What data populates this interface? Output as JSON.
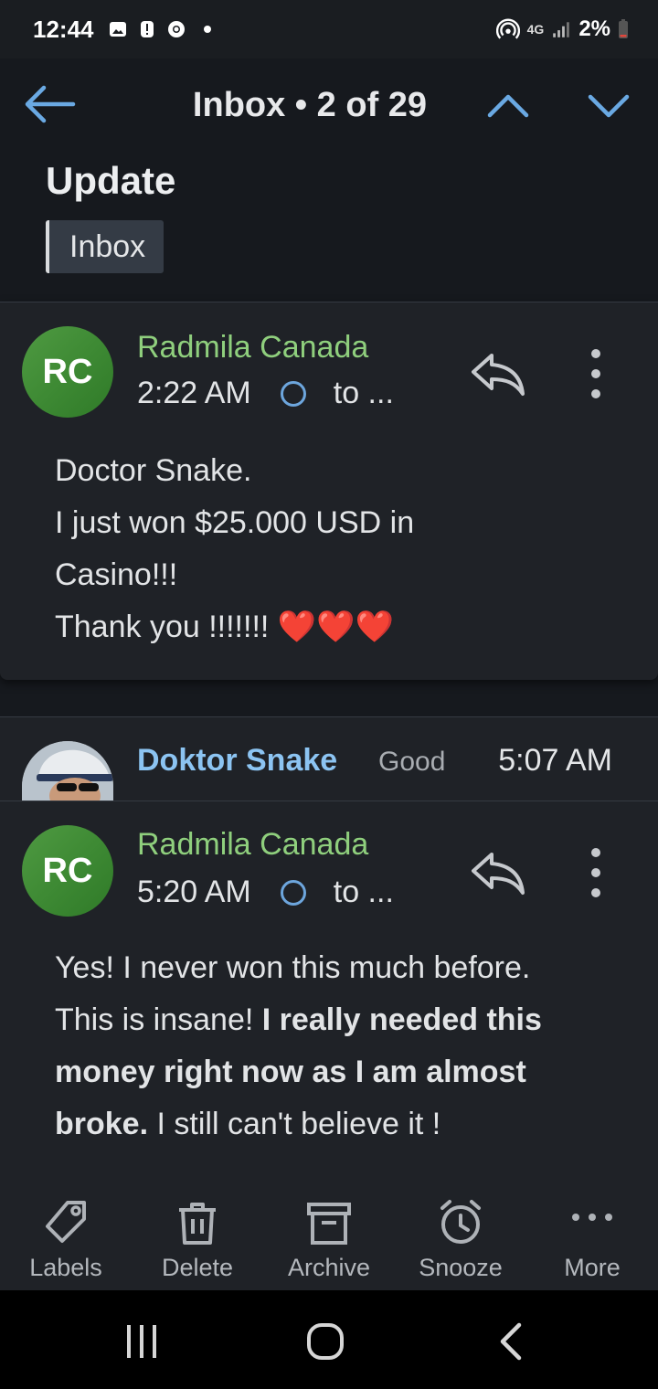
{
  "status_bar": {
    "time": "12:44",
    "network": "4G",
    "battery": "2%",
    "icons": [
      "gallery-icon",
      "alert-icon",
      "chrome-icon",
      "dot-icon",
      "hotspot-icon",
      "signal-icon",
      "battery-icon"
    ]
  },
  "header": {
    "title": "Inbox • 2 of 29",
    "subject": "Update",
    "label": "Inbox"
  },
  "messages": [
    {
      "avatar_initials": "RC",
      "sender": "Radmila Canada",
      "time": "2:22 AM",
      "recipient": "to ...",
      "body": [
        "Doctor Snake.",
        "I just won $25.000 USD in",
        "Casino!!!",
        "Thank you !!!!!!! ❤️❤️❤️"
      ]
    },
    {
      "sender": "Doktor Snake",
      "snippet": "Good",
      "time": "5:07 AM"
    },
    {
      "avatar_initials": "RC",
      "sender": "Radmila Canada",
      "time": "5:20 AM",
      "recipient": "to ...",
      "body_plain_1": "Yes! I never won this much before.",
      "body_plain_2": "This is insane!",
      "body_bold_1": "I really needed this",
      "body_bold_2": "money right now as I am almost",
      "body_bold_3": "broke.",
      "body_plain_3": "I still can't believe it !"
    }
  ],
  "action_bar": {
    "labels": "Labels",
    "delete": "Delete",
    "archive": "Archive",
    "snooze": "Snooze",
    "more": "More"
  },
  "colors": {
    "background": "#16191e",
    "card": "#1f2227",
    "sender_green": "#8fcf7d",
    "sender_blue": "#8cc4f2",
    "accent_blue": "#6da6dd",
    "avatar_green": "#3e8a34"
  }
}
